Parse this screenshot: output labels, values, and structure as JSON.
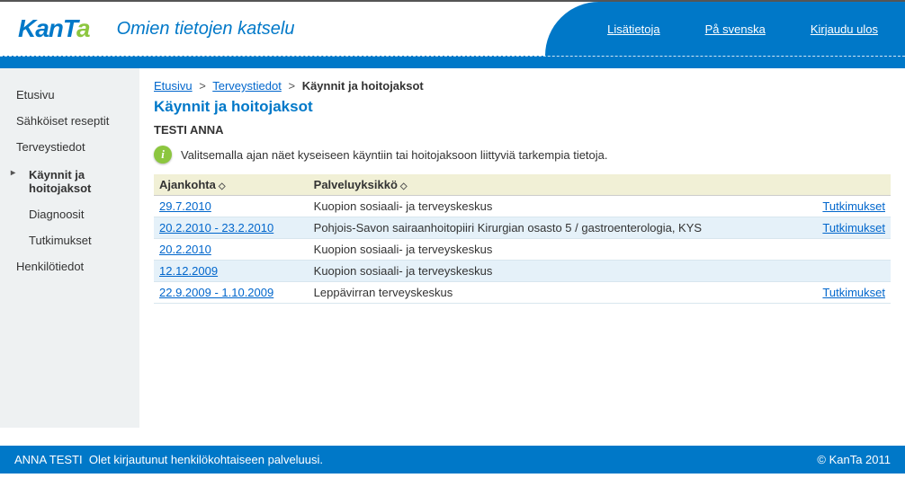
{
  "brand": "KanTa",
  "subtitle": "Omien tietojen katselu",
  "topLinks": {
    "more": "Lisätietoja",
    "sv": "På svenska",
    "logout": "Kirjaudu ulos"
  },
  "sidebar": {
    "home": "Etusivu",
    "eresepti": "Sähköiset reseptit",
    "terveys": "Terveystiedot",
    "kaynnit": "Käynnit ja hoitojaksot",
    "diag": "Diagnoosit",
    "tutk": "Tutkimukset",
    "henkilo": "Henkilötiedot"
  },
  "breadcrumb": {
    "home": "Etusivu",
    "sect": "Terveystiedot",
    "current": "Käynnit ja hoitojaksot"
  },
  "pageTitle": "Käynnit ja hoitojaksot",
  "userName": "TESTI ANNA",
  "infoText": "Valitsemalla ajan näet kyseiseen käyntiin tai hoitojaksoon liittyviä tarkempia tietoja.",
  "table": {
    "headers": {
      "date": "Ajankohta",
      "unit": "Palveluyksikkö"
    },
    "linkLabel": "Tutkimukset",
    "rows": [
      {
        "date": "29.7.2010",
        "unit": "Kuopion sosiaali- ja terveyskeskus",
        "link": true
      },
      {
        "date": "20.2.2010 - 23.2.2010",
        "unit": "Pohjois-Savon sairaanhoitopiiri Kirurgian osasto 5 / gastroenterologia, KYS",
        "link": true
      },
      {
        "date": "20.2.2010",
        "unit": "Kuopion sosiaali- ja terveyskeskus",
        "link": false
      },
      {
        "date": "12.12.2009",
        "unit": "Kuopion sosiaali- ja terveyskeskus",
        "link": false
      },
      {
        "date": "22.9.2009 - 1.10.2009",
        "unit": "Leppävirran terveyskeskus",
        "link": true
      }
    ]
  },
  "footer": {
    "name": "ANNA TESTI",
    "msg": "Olet kirjautunut henkilökohtaiseen palveluusi.",
    "copyright": "© KanTa 2011"
  }
}
